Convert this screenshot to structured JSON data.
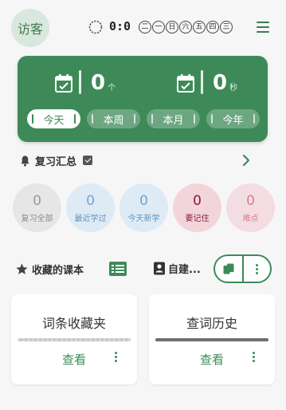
{
  "header": {
    "avatar_label": "访客",
    "timer": "0:0",
    "weekdays": [
      "二",
      "一",
      "日",
      "六",
      "五",
      "四",
      "三"
    ]
  },
  "stats": {
    "count_value": "0",
    "count_unit": "个",
    "time_value": "0",
    "time_unit": "秒",
    "periods": [
      "今天",
      "本周",
      "本月",
      "今年"
    ],
    "active_period": "今天"
  },
  "review": {
    "title": "复习汇总",
    "items": [
      {
        "count": "0",
        "label": "复习全部"
      },
      {
        "count": "0",
        "label": "最近学过"
      },
      {
        "count": "0",
        "label": "今天新学"
      },
      {
        "count": "0",
        "label": "要记住"
      },
      {
        "count": "0",
        "label": "难点"
      }
    ]
  },
  "favorites": {
    "title": "收藏的课本",
    "own_title": "自建..."
  },
  "cards": [
    {
      "title": "词条收藏夹",
      "action": "查看"
    },
    {
      "title": "查词历史",
      "action": "查看"
    }
  ],
  "colors": {
    "accent": "#3d8a58",
    "avatar_bg": "#d9e8dd"
  }
}
